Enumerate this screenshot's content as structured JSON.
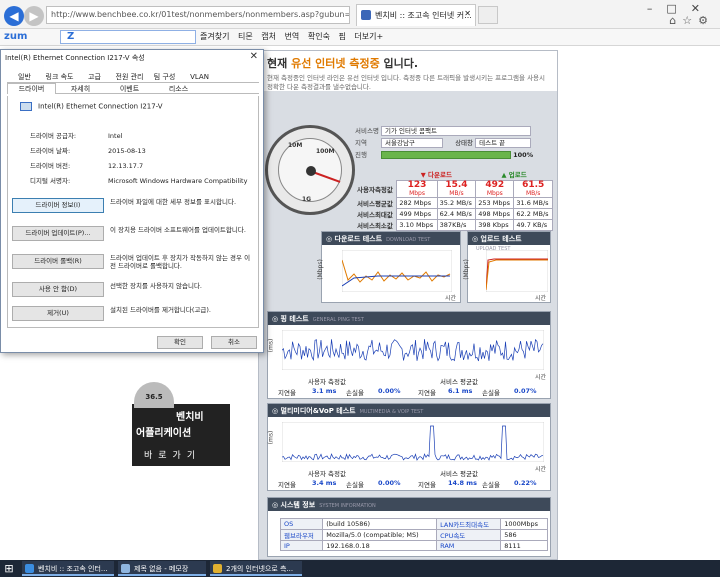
{
  "browser": {
    "url": "http://www.benchbee.co.kr/01test/nonmembers/nonmembers.asp?gubun=",
    "tab_title": "벤치비 :: 조고속 인터넷 커...",
    "toolbar_logo": "zum",
    "toolbar_search": "Z",
    "toolbar_items": [
      "즐겨찾기",
      "티몬",
      "캡처",
      "번역",
      "확인숙",
      "핌",
      "더보기+"
    ]
  },
  "dialog": {
    "title": "Intel(R) Ethernet Connection I217-V 속성",
    "close": "✕",
    "tabs_row1": [
      "일반",
      "링크 속도",
      "고급",
      "전원 관리",
      "팀 구성",
      "VLAN"
    ],
    "tabs_row2": [
      "드라이버",
      "자세히",
      "이벤트",
      "리소스"
    ],
    "device_name": "Intel(R) Ethernet Connection I217-V",
    "properties": [
      {
        "k": "드라이버 공급자:",
        "v": "Intel"
      },
      {
        "k": "드라이버 날짜:",
        "v": "2015-08-13"
      },
      {
        "k": "드라이버 버전:",
        "v": "12.13.17.7"
      },
      {
        "k": "디지털 서명자:",
        "v": "Microsoft Windows Hardware Compatibility"
      }
    ],
    "buttons": [
      {
        "label": "드라이버 정보(I)",
        "desc": "드라이버 파일에 대한 세부 정보를 표시합니다."
      },
      {
        "label": "드라이버 업데이트(P)...",
        "desc": "이 장치용 드라이버 소프트웨어를 업데이트합니다."
      },
      {
        "label": "드라이버 롤백(R)",
        "desc": "드라이버 업데이트 후 장치가 작동하지 않는 경우 이전 드라이버로 롤백합니다."
      },
      {
        "label": "사용 안 함(D)",
        "desc": "선택한 장치를 사용하지 않습니다."
      },
      {
        "label": "제거(U)",
        "desc": "설치된 드라이버를 제거합니다(고급)."
      }
    ],
    "ok": "확인",
    "cancel": "취소"
  },
  "promo": {
    "gauge": "36.5",
    "line1": "벤치비",
    "line2": "어플리케이션",
    "line3": "바로가기"
  },
  "bench": {
    "head_title_pre": "현재 ",
    "head_title_hl": "유선 인터넷 측정중",
    "head_title_post": " 입니다.",
    "head_desc": "현재 측정중인 인터넷 라인은 유선 인터넷 입니다. 측정중 다른 트래픽을 발생시키는 프로그램을 사용시 정확한 다운 측정결과를 낼수없습니다.",
    "gauge_labels": [
      "10M",
      "100M",
      "1G"
    ],
    "service_label": "서비스명",
    "service_value": "기가 인터넷 콤팩트",
    "region_label": "지역",
    "region_value": "서울강남구",
    "status_label": "상태창",
    "status_value": "테스트 끝",
    "progress_label": "진행",
    "progress_value": "100%",
    "progress": 1.0,
    "stats_head": [
      "다운로드",
      "업로드"
    ],
    "stats": [
      {
        "k": "사용자측정값",
        "d1": "123",
        "d1u": "Mbps",
        "d2": "15.4",
        "d2u": "MB/s",
        "u1": "492",
        "u1u": "Mbps",
        "u2": "61.5",
        "u2u": "MB/s"
      },
      {
        "k": "서비스평균값",
        "d1": "282 Mbps",
        "d2": "35.2 MB/s",
        "u1": "253 Mbps",
        "u2": "31.6 MB/s"
      },
      {
        "k": "서비스최대값",
        "d1": "499 Mbps",
        "d2": "62.4 MB/s",
        "u1": "498 Mbps",
        "u2": "62.2 MB/s"
      },
      {
        "k": "서비스최소값",
        "d1": "3.10 Mbps",
        "d2": "387KB/s",
        "u1": "398 Kbps",
        "u2": "49.7 KB/s"
      }
    ],
    "download_title": "다운로드 테스트",
    "download_sub": "DOWNLOAD TEST",
    "upload_title": "업로드 테스트",
    "upload_sub": "UPLOAD TEST",
    "ping_title": "핑 테스트",
    "ping_sub": "GENERAL PING TEST",
    "vop_title": "멀티미디어&VoP 테스트",
    "vop_sub": "MULTIMEDIA & VOIP TEST",
    "sys_title": "시스템 정보",
    "sys_sub": "SYSTEM INFORMATION",
    "y_mbps": "(Mbps)",
    "y_ms": "(ms)",
    "x_time": "시간",
    "ping_row1": {
      "a": "사용자 측정값",
      "b": "서비스 평균값"
    },
    "ping_row2": {
      "k1": "지연율",
      "v1": "3.1 ms",
      "k2": "손실율",
      "v2": "0.00%",
      "k3": "지연율",
      "v3": "6.1 ms",
      "k4": "손실율",
      "v4": "0.07%"
    },
    "vop_row1": {
      "a": "사용자 측정값",
      "b": "서비스 평균값"
    },
    "vop_row2": {
      "k1": "지연율",
      "v1": "3.4 ms",
      "k2": "손실율",
      "v2": "0.00%",
      "k3": "지연율",
      "v3": "14.8 ms",
      "k4": "손실율",
      "v4": "0.22%"
    },
    "sysinfo": [
      {
        "k1": "OS",
        "v1": "(build 10586)",
        "k2": "LAN카드최대속도",
        "v2": "1000Mbps"
      },
      {
        "k1": "웹브라우저",
        "v1": "Mozilla/5.0 (compatible; MS)",
        "k2": "CPU속도",
        "v2": "586"
      },
      {
        "k1": "IP",
        "v1": "192.168.0.18",
        "k2": "RAM",
        "v2": "8111"
      }
    ]
  },
  "taskbar": {
    "items": [
      "벤치비 :: 조고속 인터...",
      "제목 없음 - 메모장",
      "2개의 인터넷으로 측..."
    ]
  },
  "colors": {
    "accent": "#2b6ed6",
    "panel_header": "#3e4a5a",
    "chart_line": "#1a3fb5",
    "download_orange": "#e07a00",
    "progress_green": "#6ab54b"
  }
}
